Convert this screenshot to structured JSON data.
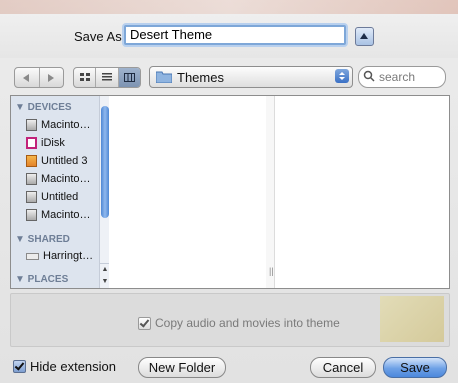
{
  "dialog": {
    "save_as_label": "Save As:",
    "filename_value": "Desert Theme"
  },
  "toolbar": {
    "back_icon": "chevron-left",
    "forward_icon": "chevron-right",
    "view_modes": [
      "icon-view",
      "list-view",
      "column-view"
    ],
    "active_view": "column-view",
    "location": "Themes",
    "search_placeholder": "search"
  },
  "sidebar": {
    "devices_header": "▼ DEVICES",
    "devices": [
      {
        "label": "Macinto…",
        "icon": "hard-drive"
      },
      {
        "label": "iDisk",
        "icon": "idisk"
      },
      {
        "label": "Untitled 3",
        "icon": "document"
      },
      {
        "label": "Macinto…",
        "icon": "hard-drive"
      },
      {
        "label": "Untitled",
        "icon": "hard-drive"
      },
      {
        "label": "Macinto…",
        "icon": "hard-drive"
      }
    ],
    "shared_header": "▼ SHARED",
    "shared": [
      {
        "label": "Harringt…",
        "icon": "network-computer"
      }
    ],
    "places_header": "▼ PLACES"
  },
  "options": {
    "copy_audio_label": "Copy audio and movies into theme",
    "copy_audio_checked": true
  },
  "footer": {
    "hide_extension_label": "Hide extension",
    "hide_extension_checked": true,
    "new_folder_label": "New Folder",
    "cancel_label": "Cancel",
    "save_label": "Save"
  },
  "colors": {
    "accent": "#4c88dc",
    "sidebar_bg": "#dde4ee",
    "sidebar_header": "#6e7e96"
  }
}
